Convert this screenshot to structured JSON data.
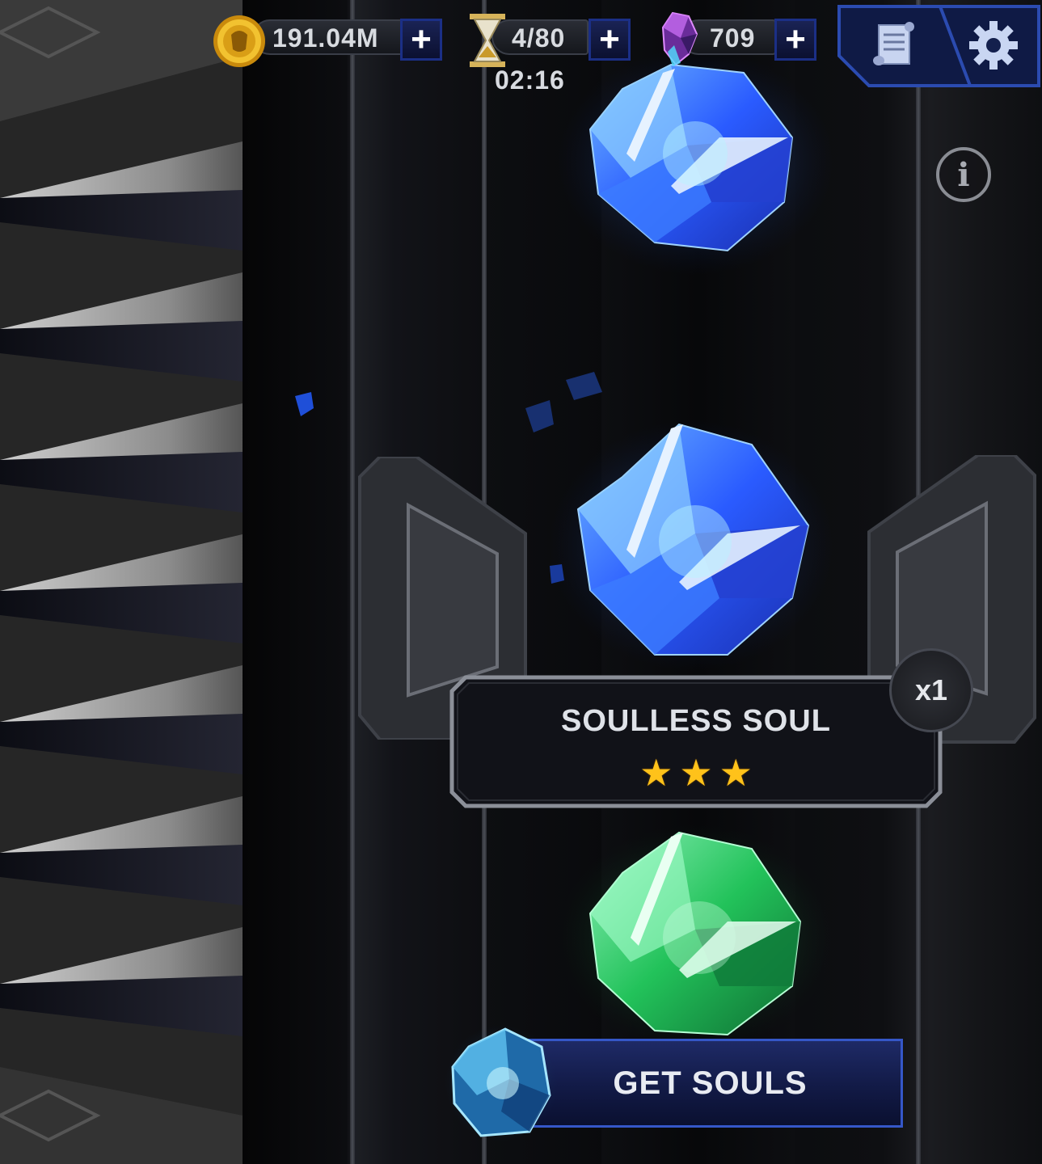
{
  "currencies": {
    "gold": {
      "icon": "gold-coin-icon",
      "value": "191.04M"
    },
    "energy": {
      "icon": "hourglass-icon",
      "value": "4/80",
      "timer": "02:16"
    },
    "units": {
      "icon": "crystal-unit-icon",
      "value": "709"
    }
  },
  "top_buttons": [
    "scroll-quests-icon",
    "gear-icon"
  ],
  "item": {
    "name": "SOULLESS SOUL",
    "stars": 3,
    "quantity": "x1"
  },
  "crystals": [
    {
      "icon": "blue-crystal-icon",
      "color": "#2a5bff"
    },
    {
      "icon": "blue-crystal-icon",
      "color": "#2a5bff"
    },
    {
      "icon": "green-crystal-icon",
      "color": "#22c25a"
    }
  ],
  "actions": {
    "get_souls": "GET SOULS"
  },
  "colors": {
    "button_blue": "#1e2a66",
    "button_border": "#3557c8",
    "star": "#ffc21a",
    "plus_border": "#1b2f86"
  }
}
